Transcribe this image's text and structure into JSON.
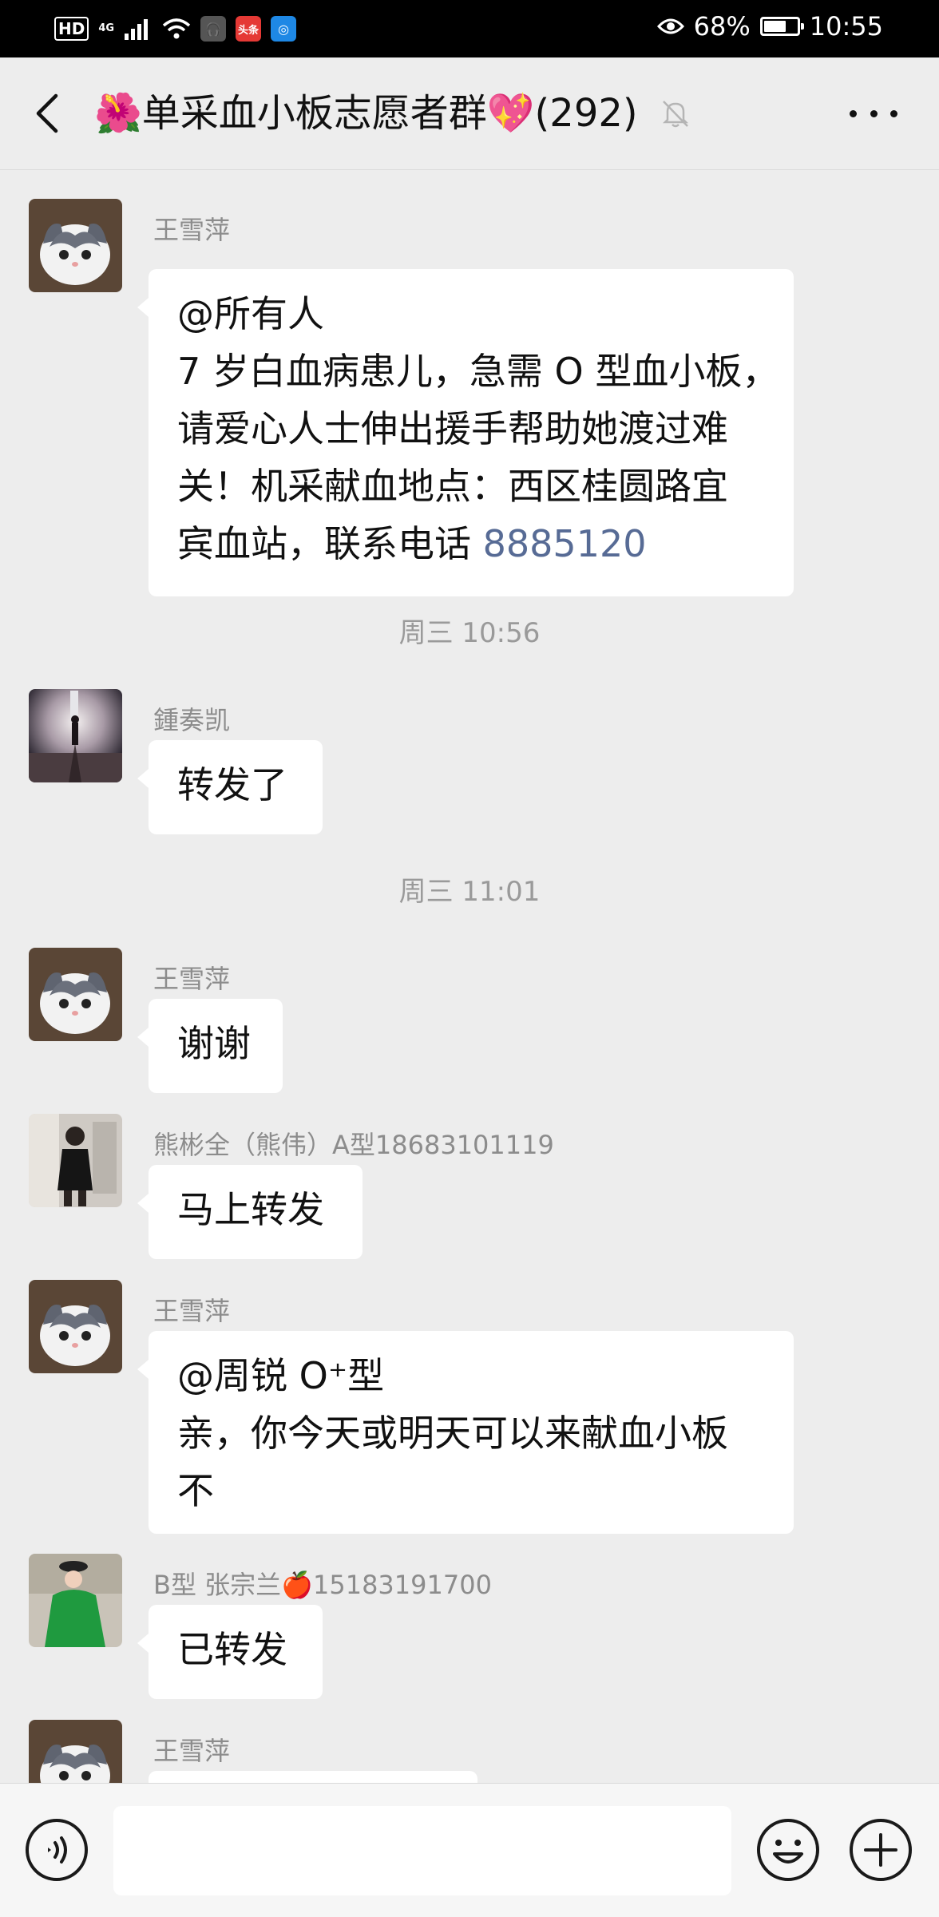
{
  "status_bar": {
    "hd": "HD",
    "network": "4G",
    "app_badge": "头条",
    "battery": "68%",
    "battery_level": 0.68,
    "time": "10:55"
  },
  "header": {
    "title": "单采血小板志愿者群",
    "title_prefix_emoji": "🌺",
    "title_suffix_emoji": "💖",
    "member_count": "(292)"
  },
  "messages": [
    {
      "sender": "王雪萍",
      "lines": [
        "@所有人",
        "7 岁白血病患儿，急需 O 型血小板，",
        "请爱心人士伸出援手帮助她渡过难",
        "关！机采献血地点：西区桂圆路宜"
      ],
      "last_line_text": "宾血站，联系电话 ",
      "last_line_link": "8885120"
    },
    {
      "timestamp": "周三 10:56"
    },
    {
      "sender": "鍾奏凯",
      "text": "转发了"
    },
    {
      "timestamp": "周三 11:01"
    },
    {
      "sender": "王雪萍",
      "text": "谢谢"
    },
    {
      "sender": "熊彬全（熊伟）A型18683101119",
      "text": "马上转发"
    },
    {
      "sender": "王雪萍",
      "lines": [
        "@周锐 O⁺型",
        "亲，你今天或明天可以来献血小板",
        "不"
      ]
    },
    {
      "sender_prefix": "B型 张宗兰",
      "sender_emoji": "🍎",
      "sender_suffix": "15183191700",
      "text": "已转发"
    },
    {
      "sender": "王雪萍",
      "text": ""
    }
  ],
  "icons": {
    "back": "back-arrow-icon",
    "mute": "bell-muted-icon",
    "more": "more-dots-icon",
    "voice": "voice-icon",
    "emoji": "emoji-icon",
    "plus": "plus-icon"
  }
}
